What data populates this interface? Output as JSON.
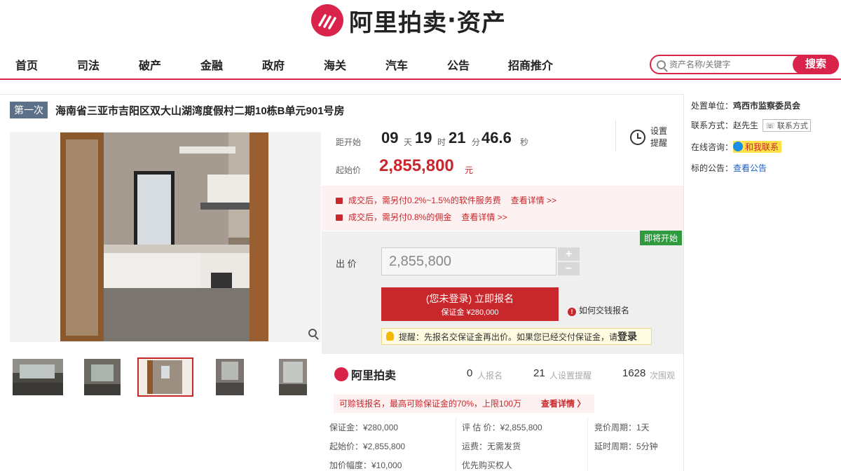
{
  "logo": {
    "brand": "阿里拍卖",
    "sep": "·",
    "section": "资产"
  },
  "nav": {
    "items": [
      "首页",
      "司法",
      "破产",
      "金融",
      "政府",
      "海关",
      "汽车",
      "公告",
      "招商推介"
    ],
    "search_placeholder": "资产名称/关键字",
    "search_button": "搜索"
  },
  "item": {
    "round": "第一次",
    "title": "海南省三亚市吉阳区双大山湖湾度假村二期10栋B单元901号房"
  },
  "countdown": {
    "label": "距开始",
    "days": "09",
    "days_unit": "天",
    "hours": "19",
    "hours_unit": "时",
    "minutes": "21",
    "minutes_unit": "分",
    "seconds": "46.6",
    "seconds_unit": "秒"
  },
  "start_price": {
    "label": "起始价",
    "value": "2,855,800",
    "unit": "元"
  },
  "remind": {
    "label": "设置提醒"
  },
  "fees": [
    {
      "text": "成交后，需另付0.2%~1.5%的软件服务费",
      "link": "查看详情 >>"
    },
    {
      "text": "成交后，需另付0.8%的佣金",
      "link": "查看详情 >>"
    }
  ],
  "bid": {
    "status_tag": "即将开始",
    "label": "出 价",
    "value": "2,855,800",
    "plus": "+",
    "minus": "−",
    "signup_main": "(您未登录) 立即报名",
    "signup_sub": "保证金 ¥280,000",
    "howto": "如何交钱报名",
    "tip_text": "提醒：先报名交保证金再出价。如果您已经交付保证金，请",
    "tip_login": "登录"
  },
  "stats": {
    "brand": "阿里拍卖",
    "signups": "0",
    "signups_label": "人报名",
    "reminders": "21",
    "reminders_label": "人设置提醒",
    "views": "1628",
    "views_label": "次围观"
  },
  "pay_banner": {
    "text": "可赊钱报名，最高可赊保证金的70%，上限100万",
    "link": "查看详情 〉"
  },
  "details": {
    "deposit": "保证金：¥280,000",
    "start": "起始价：¥2,855,800",
    "increment": "加价幅度：¥10,000",
    "appraisal": "评 估 价：¥2,855,800",
    "shipping": "运费：无需发货",
    "priority": "优先购买权人",
    "cycle": "竞价周期：1天",
    "delay": "延时周期：5分钟"
  },
  "sidebar": {
    "unit_label": "处置单位：",
    "unit_value": "鸡西市监察委员会",
    "contact_label": "联系方式：",
    "contact_name": "赵先生",
    "contact_btn": "联系方式",
    "consult_label": "在线咨询：",
    "consult_btn": "和我联系",
    "notice_label": "标的公告：",
    "notice_link": "查看公告"
  },
  "colors": {
    "accent": "#d9234b",
    "price_red": "#c8272b",
    "round_badge": "#5d7089",
    "status_green": "#2f9b3e"
  }
}
